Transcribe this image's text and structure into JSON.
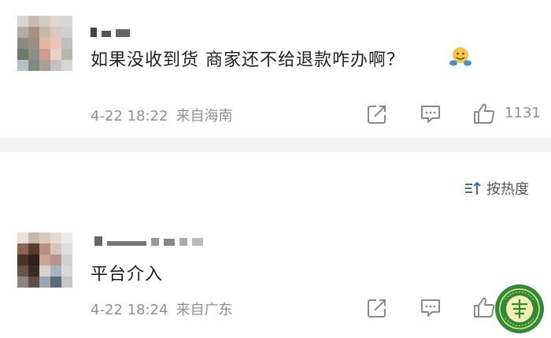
{
  "comments": [
    {
      "text": "如果没收到货 商家还不给退款咋办啊？",
      "date": "4-22 18:22",
      "location": "来自海南",
      "likes": "1131",
      "emoji": "hugging-face-emoji"
    },
    {
      "text": "平台介入",
      "date": "4-22 18:24",
      "location": "来自广东",
      "likes": ""
    }
  ],
  "sort": {
    "label": "按热度",
    "icon": "sort-icon"
  },
  "icons": {
    "share": "share-icon",
    "comment": "comment-icon",
    "like": "thumbs-up-icon"
  },
  "colors": {
    "meta_text": "#909090",
    "icon": "#8a8a8a",
    "divider": "#f2f2f2",
    "seal_green": "#2e8b3a"
  }
}
